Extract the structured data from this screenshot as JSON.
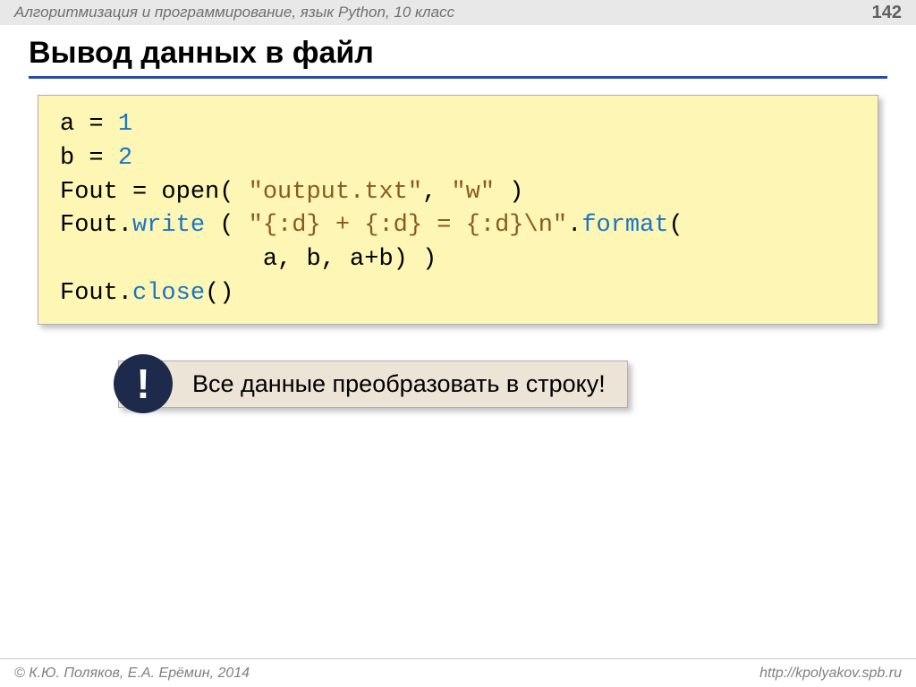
{
  "header": {
    "course": "Алгоритмизация и программирование, язык Python, 10 класс",
    "page": "142"
  },
  "title": "Вывод данных в файл",
  "code": {
    "line1_a": "a = ",
    "line1_b": "1",
    "line2_a": "b = ",
    "line2_b": "2",
    "line3_a": "Fout = open( ",
    "line3_str1": "\"output.txt\"",
    "line3_b": ", ",
    "line3_str2": "\"w\"",
    "line3_c": " )",
    "line4_a": "Fout.",
    "line4_m": "write",
    "line4_b": " ( ",
    "line4_str": "\"{:d} + {:d} = {:d}\\n\"",
    "line4_c": ".",
    "line4_m2": "format",
    "line4_d": "(",
    "line5": "              a, b, a+b) )",
    "line6_a": "Fout.",
    "line6_m": "close",
    "line6_b": "()"
  },
  "callout": {
    "badge": "!",
    "text": "Все данные преобразовать в строку!"
  },
  "footer": {
    "copyright": "© К.Ю. Поляков, Е.А. Ерёмин, 2014",
    "url": "http://kpolyakov.spb.ru"
  }
}
